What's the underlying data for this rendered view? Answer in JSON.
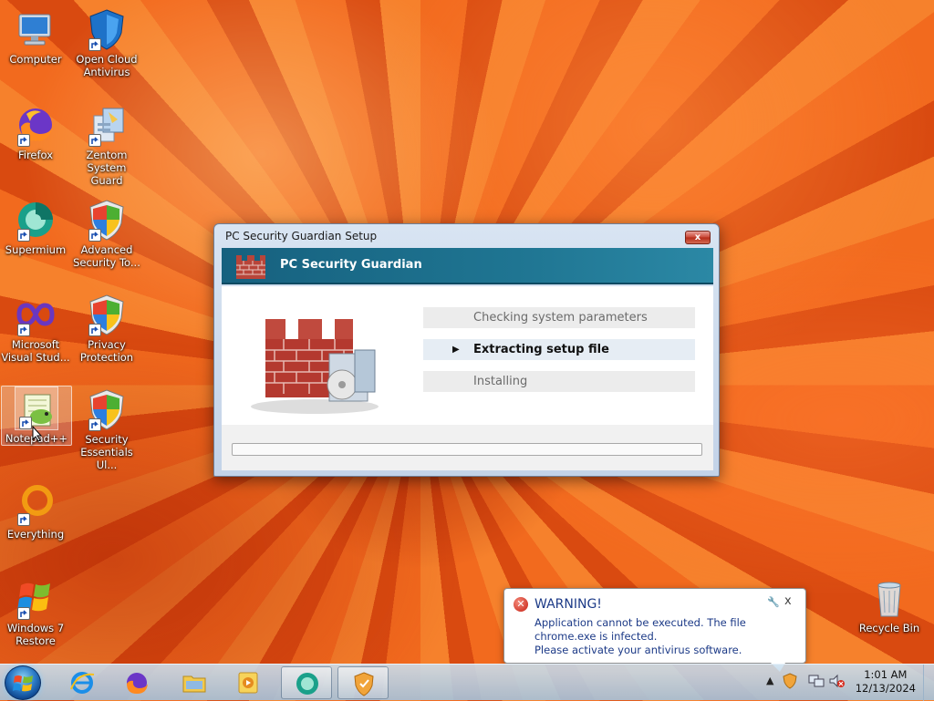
{
  "desktop": {
    "icons": [
      {
        "label": "Computer",
        "icon": "computer-icon"
      },
      {
        "label": "Open Cloud Antivirus",
        "icon": "shield-icon"
      },
      {
        "label": "Firefox",
        "icon": "firefox-icon"
      },
      {
        "label": "Zentom System Guard",
        "icon": "zentom-icon"
      },
      {
        "label": "Supermium",
        "icon": "supermium-icon"
      },
      {
        "label": "Advanced Security To...",
        "icon": "windows-shield-icon"
      },
      {
        "label": "Microsoft Visual Stud...",
        "icon": "visual-studio-icon"
      },
      {
        "label": "Privacy Protection",
        "icon": "windows-shield-icon"
      },
      {
        "label": "Notepad++",
        "icon": "notepadpp-icon"
      },
      {
        "label": "Security Essentials Ul...",
        "icon": "security-essentials-icon"
      },
      {
        "label": "Everything",
        "icon": "everything-icon"
      },
      {
        "label": "Windows 7 Restore",
        "icon": "windows-logo-icon"
      },
      {
        "label": "Recycle Bin",
        "icon": "recycle-bin-icon"
      }
    ]
  },
  "setup_window": {
    "title": "PC Security Guardian Setup",
    "close_label": "x",
    "banner_title": "PC Security Guardian",
    "steps": [
      {
        "label": "Checking system parameters",
        "state": "done"
      },
      {
        "label": "Extracting setup file",
        "state": "active"
      },
      {
        "label": "Installing",
        "state": "pending"
      }
    ],
    "progress_fraction": 0.0
  },
  "notification": {
    "title": "WARNING!",
    "message_line1": "Application cannot be executed. The file chrome.exe is infected.",
    "message_line2": "Please activate your antivirus software.",
    "close_label": "x"
  },
  "taskbar": {
    "apps": [
      {
        "icon": "internet-explorer-icon",
        "open": false
      },
      {
        "icon": "firefox-icon",
        "open": false
      },
      {
        "icon": "file-explorer-icon",
        "open": false
      },
      {
        "icon": "media-player-icon",
        "open": false
      },
      {
        "icon": "supermium-icon",
        "open": true
      },
      {
        "icon": "security-guardian-icon",
        "open": true
      }
    ],
    "clock_time": "1:01 AM",
    "clock_date": "12/13/2024"
  },
  "colors": {
    "banner": "#1f7592",
    "warning_text": "#1c3a87",
    "warning_icon": "#c61f12"
  }
}
